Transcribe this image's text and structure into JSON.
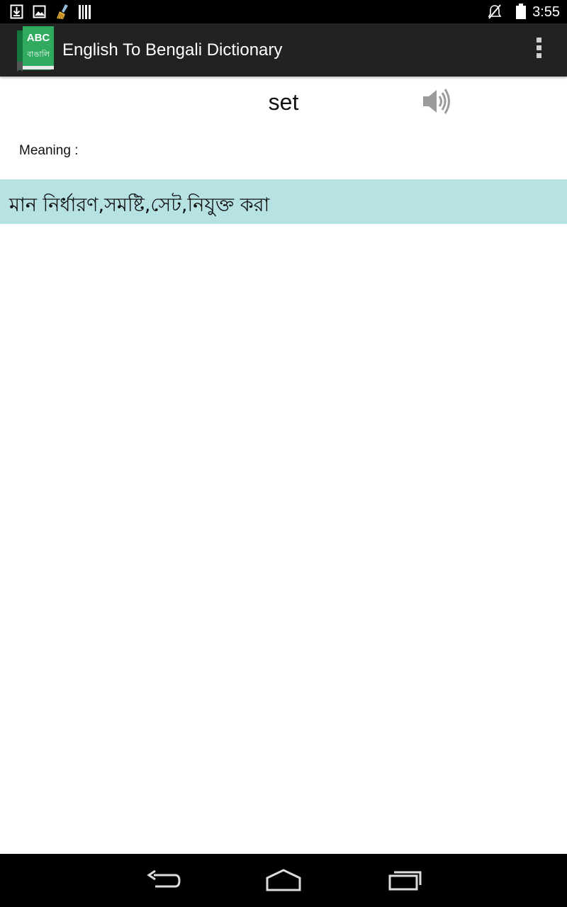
{
  "status_bar": {
    "time": "3:55",
    "icons": [
      "download-icon",
      "image-icon",
      "broom-icon",
      "barcode-icon",
      "muted-icon",
      "battery-icon"
    ]
  },
  "action_bar": {
    "logo_top_text": "ABC",
    "logo_bottom_text": "বাঙালি",
    "title": "English To Bengali Dictionary"
  },
  "entry": {
    "word": "set",
    "meaning_label": "Meaning :",
    "meaning": "মান নির্ধারণ,সমষ্টি,সেট,নিযুক্ত করা"
  },
  "colors": {
    "status_bar_bg": "#000000",
    "action_bar_bg": "#222222",
    "logo_green": "#2faa5f",
    "meaning_bg": "#b6e2e3",
    "nav_bar_bg": "#000000"
  },
  "nav_bar": {
    "icons": [
      "back-icon",
      "home-icon",
      "recents-icon"
    ]
  }
}
